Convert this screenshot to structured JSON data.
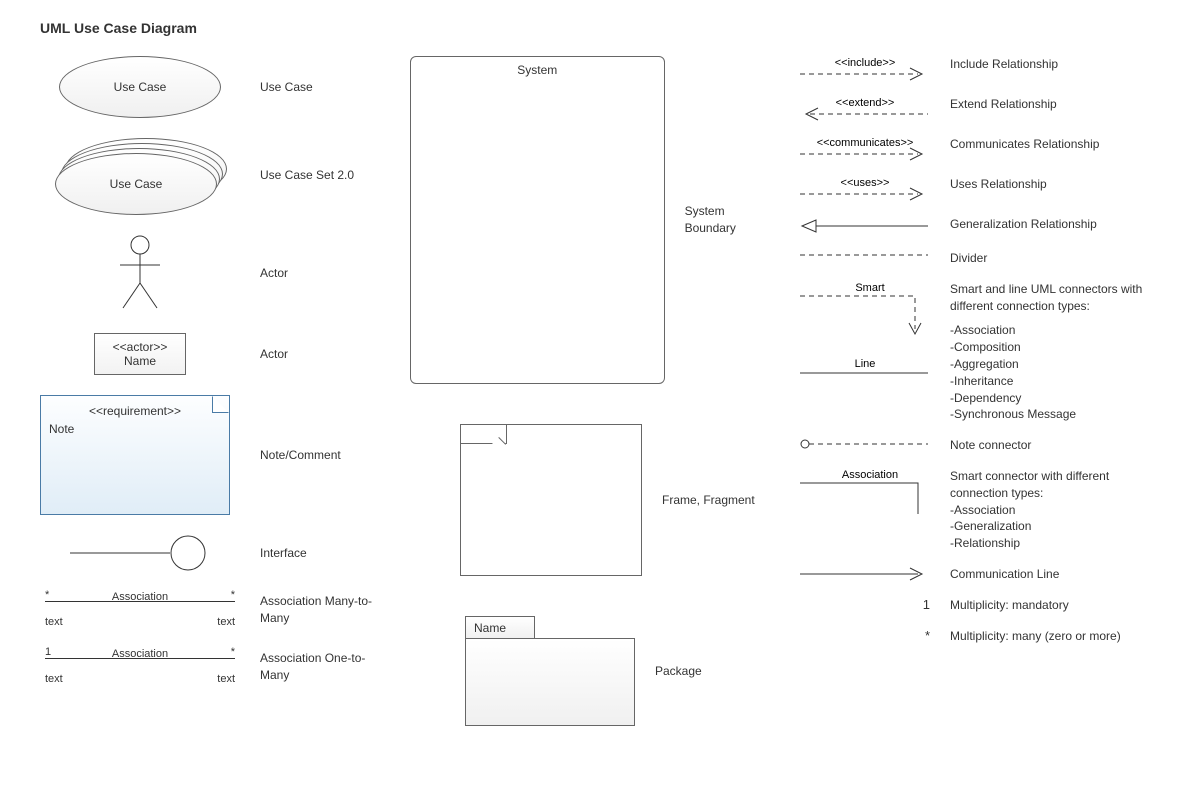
{
  "title": "UML Use Case Diagram",
  "left": {
    "usecase": {
      "text": "Use Case",
      "label": "Use Case"
    },
    "usecase_set": {
      "text": "Use Case",
      "label": "Use Case Set 2.0"
    },
    "actor_stick": {
      "label": "Actor"
    },
    "actor_box": {
      "stereo": "<<actor>>",
      "name": "Name",
      "label": "Actor"
    },
    "note": {
      "stereo": "<<requirement>>",
      "text": "Note",
      "label": "Note/Comment"
    },
    "interface": {
      "label": "Interface"
    },
    "assoc_mm": {
      "line_label": "Association",
      "left_mult": "*",
      "right_mult": "*",
      "left_text": "text",
      "right_text": "text",
      "label": "Association Many-to-Many"
    },
    "assoc_om": {
      "line_label": "Association",
      "left_mult": "1",
      "right_mult": "*",
      "left_text": "text",
      "right_text": "text",
      "label": "Association One-to-Many"
    }
  },
  "middle": {
    "system": {
      "title": "System",
      "label": "System Boundary"
    },
    "frame": {
      "label": "Frame, Fragment"
    },
    "package": {
      "tab": "Name",
      "label": "Package"
    }
  },
  "right": {
    "include": {
      "stereo": "<<include>>",
      "label": "Include Relationship"
    },
    "extend": {
      "stereo": "<<extend>>",
      "label": "Extend Relationship"
    },
    "communicates": {
      "stereo": "<<communicates>>",
      "label": "Communicates Relationship"
    },
    "uses": {
      "stereo": "<<uses>>",
      "label": "Uses Relationship"
    },
    "generalization": {
      "label": "Generalization Relationship"
    },
    "divider": {
      "label": "Divider"
    },
    "smart": {
      "text": "Smart",
      "line_text": "Line",
      "label_1": "Smart and line UML connectors with different connection types:",
      "types": "-Association\n-Composition\n-Aggregation\n-Inheritance\n-Dependency\n-Synchronous Message"
    },
    "note_connector": {
      "label": "Note connector"
    },
    "association": {
      "text": "Association",
      "label_1": "Smart connector with different connection types:",
      "types": "-Association\n-Generalization\n-Relationship"
    },
    "comm_line": {
      "label": "Communication Line"
    },
    "mult_1": {
      "symbol": "1",
      "label": "Multiplicity: mandatory"
    },
    "mult_star": {
      "symbol": "*",
      "label": "Multiplicity: many (zero or more)"
    }
  }
}
